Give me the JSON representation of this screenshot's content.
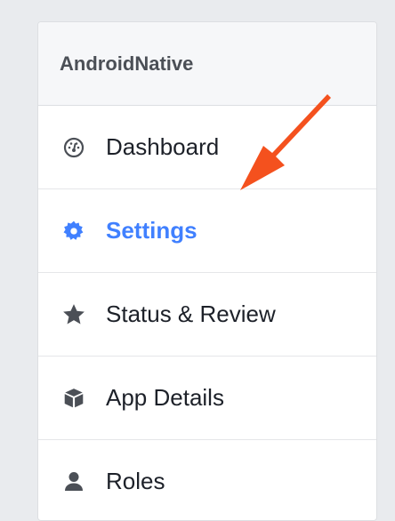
{
  "app": {
    "name": "AndroidNative"
  },
  "nav": {
    "items": [
      {
        "key": "dashboard",
        "label": "Dashboard",
        "icon": "gauge-icon",
        "active": false
      },
      {
        "key": "settings",
        "label": "Settings",
        "icon": "gear-icon",
        "active": true
      },
      {
        "key": "status",
        "label": "Status & Review",
        "icon": "star-icon",
        "active": false
      },
      {
        "key": "app-details",
        "label": "App Details",
        "icon": "cube-icon",
        "active": false
      },
      {
        "key": "roles",
        "label": "Roles",
        "icon": "person-icon",
        "active": false
      }
    ]
  },
  "colors": {
    "accent": "#4080ff",
    "arrow": "#f4511e",
    "text": "#1d2129",
    "background": "#e9ebee"
  },
  "annotation": {
    "arrow_icon": "red-arrow-pointer"
  }
}
